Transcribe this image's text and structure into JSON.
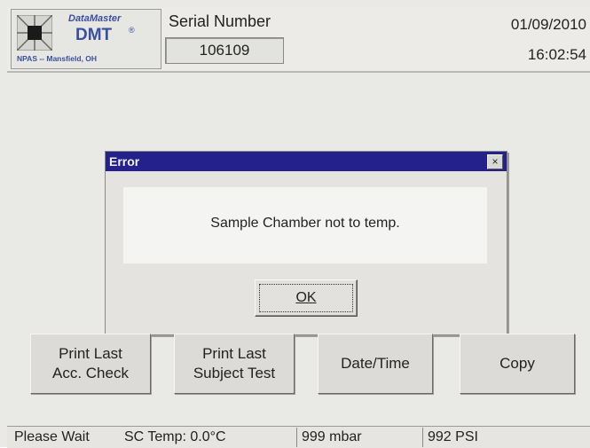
{
  "header": {
    "logo_line1": "DataMaster",
    "logo_line2": "DMT",
    "logo_reg": "®",
    "logo_line3": "NPAS -- Mansfield, OH",
    "serial_label": "Serial Number",
    "serial_value": "106109",
    "date": "01/09/2010",
    "time": "16:02:54"
  },
  "dialog": {
    "title": "Error",
    "close_glyph": "×",
    "message": "Sample Chamber not to temp.",
    "ok_label": "OK"
  },
  "buttons": {
    "print_acc_line1": "Print Last",
    "print_acc_line2": "Acc. Check",
    "print_subject_line1": "Print Last",
    "print_subject_line2": "Subject Test",
    "datetime": "Date/Time",
    "copy": "Copy"
  },
  "status": {
    "state": "Please Wait",
    "sc_temp": "SC Temp: 0.0°C",
    "pressure_mbar": "999 mbar",
    "pressure_psi": "992 PSI"
  },
  "icons": {
    "logo": "datamaster-logo-icon",
    "close": "close-icon"
  }
}
